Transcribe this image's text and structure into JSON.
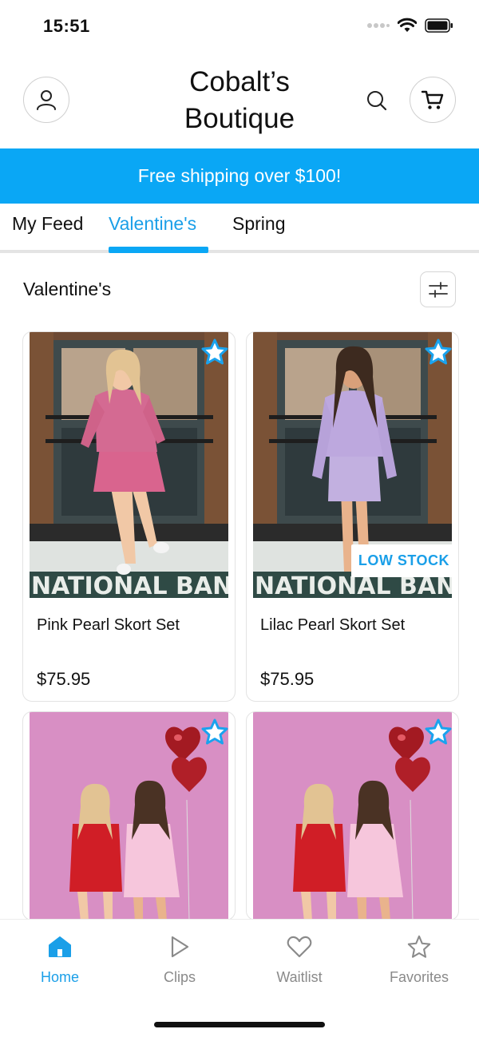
{
  "status_bar": {
    "time": "15:51"
  },
  "header": {
    "title_line1": "Cobalt’s",
    "title_line2": "Boutique"
  },
  "promo": {
    "text": "Free shipping over $100!"
  },
  "tabs": [
    {
      "label": "My Feed",
      "active": false
    },
    {
      "label": "Valentine's",
      "active": true
    },
    {
      "label": "Spring",
      "active": false
    }
  ],
  "section": {
    "title": "Valentine's"
  },
  "products": [
    {
      "name": "Pink Pearl Skort Set",
      "price": "$75.95",
      "badge": "",
      "icon": "star-icon"
    },
    {
      "name": "Lilac Pearl Skort Set",
      "price": "$75.95",
      "badge": "LOW STOCK",
      "icon": "star-icon"
    },
    {
      "name": "",
      "price": "",
      "badge": "",
      "icon": "star-icon"
    },
    {
      "name": "",
      "price": "",
      "badge": "",
      "icon": "star-icon"
    }
  ],
  "bottom_nav": [
    {
      "label": "Home",
      "icon": "home-icon",
      "active": true
    },
    {
      "label": "Clips",
      "icon": "play-icon",
      "active": false
    },
    {
      "label": "Waitlist",
      "icon": "heart-icon",
      "active": false
    },
    {
      "label": "Favorites",
      "icon": "star-icon",
      "active": false
    }
  ],
  "colors": {
    "accent": "#0aa7f5",
    "active_text": "#1a9fe8"
  }
}
